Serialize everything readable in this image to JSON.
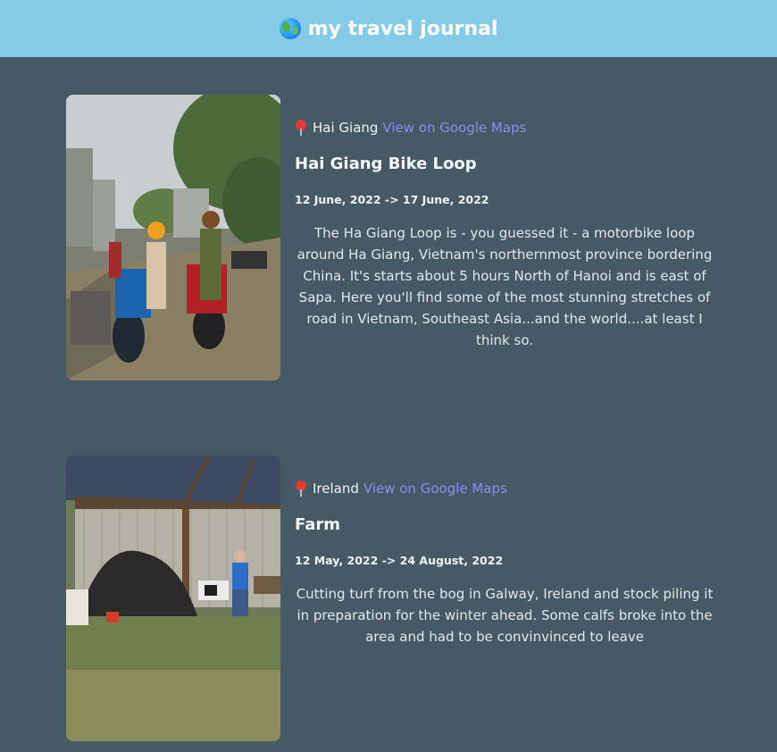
{
  "header": {
    "title": "my travel journal",
    "icon": "globe-icon",
    "background": "#84cbe7"
  },
  "entries": [
    {
      "location": "Hai Giang",
      "maps_label": "View on Google Maps",
      "title": "Hai Giang Bike Loop",
      "dates": "12 June, 2022 -> 17 June, 2022",
      "description": "The Ha Giang Loop is - you guessed it - a motorbike loop around Ha Giang, Vietnam's northernmost province bordering China. It's starts about 5 hours North of Hanoi and is east of Sapa. Here you'll find some of the most stunning stretches of road in Vietnam, Southeast Asia...and the world....at least I think so."
    },
    {
      "location": "Ireland",
      "maps_label": "View on Google Maps",
      "title": "Farm",
      "dates": "12 May, 2022 -> 24 August, 2022",
      "description": "Cutting turf from the bog in Galway, Ireland and stock piling it in preparation for the winter ahead. Some calfs broke into the area and had to be convinvinced to leave"
    }
  ],
  "colors": {
    "page_background": "#455a64",
    "link": "#8c8cf5"
  }
}
